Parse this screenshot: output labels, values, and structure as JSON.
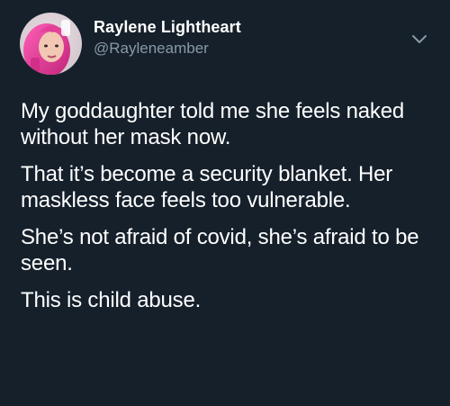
{
  "tweet": {
    "author": {
      "display_name": "Raylene Lightheart",
      "handle": "@Rayleneamber",
      "avatar_icon": "profile-photo"
    },
    "menu_icon": "chevron-down-icon",
    "paragraphs": [
      "My goddaughter told me she feels naked without her mask now.",
      "That it’s become a security blanket. Her maskless face feels too vulnerable.",
      "She’s not afraid of covid, she’s afraid to be seen.",
      "This is child abuse."
    ]
  },
  "colors": {
    "background": "#15202b",
    "text": "#ffffff",
    "secondary_text": "#8899a6"
  }
}
